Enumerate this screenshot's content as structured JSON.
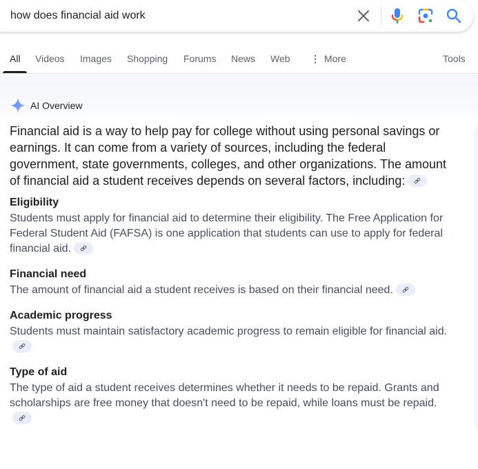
{
  "search": {
    "query": "how does financial aid work"
  },
  "tabs": [
    {
      "label": "All",
      "active": true
    },
    {
      "label": "Videos"
    },
    {
      "label": "Images"
    },
    {
      "label": "Shopping"
    },
    {
      "label": "Forums"
    },
    {
      "label": "News"
    },
    {
      "label": "Web"
    },
    {
      "label": "More"
    }
  ],
  "tools_label": "Tools",
  "ai_overview": {
    "title": "AI Overview",
    "lead": "Financial aid is a way to help pay for college without using personal savings or earnings. It can come from a variety of sources, including the federal government, state governments, colleges, and other organizations. The amount of financial aid a student receives depends on several factors, including:",
    "sections": [
      {
        "title": "Eligibility",
        "body": "Students must apply for financial aid to determine their eligibility. The Free Application for Federal Student Aid (FAFSA) is one application that students can use to apply for federal financial aid."
      },
      {
        "title": "Financial need",
        "body": "The amount of financial aid a student receives is based on their financial need."
      },
      {
        "title": "Academic progress",
        "body": "Students must maintain satisfactory academic progress to remain eligible for financial aid."
      },
      {
        "title": "Type of aid",
        "body": "The type of aid a student receives determines whether it needs to be repaid. Grants and scholarships are free money that doesn't need to be repaid, while loans must be repaid."
      }
    ]
  },
  "icons": {
    "clear": "close-icon",
    "mic": "microphone-icon",
    "lens": "google-lens-icon",
    "search": "search-icon",
    "more": "vertical-dots-icon",
    "spark": "gemini-sparkle-icon",
    "cite": "link-icon"
  },
  "colors": {
    "google_blue": "#4285f4",
    "google_red": "#ea4335",
    "google_yellow": "#fbbc04",
    "google_green": "#34a853",
    "body_text": "#474e63",
    "heading_text": "#1f1f1f",
    "cite_bg": "#e8eefa"
  }
}
